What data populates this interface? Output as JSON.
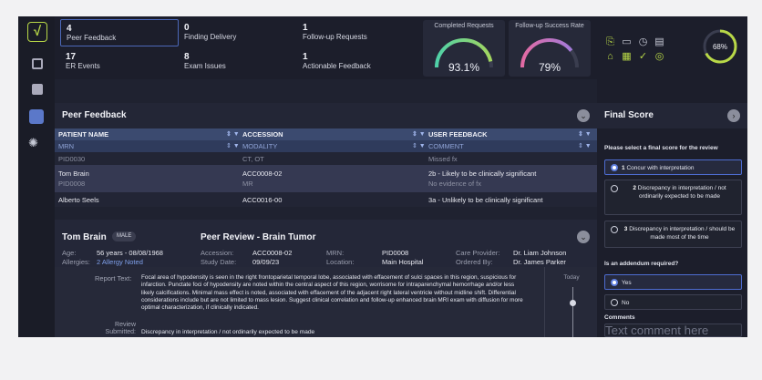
{
  "stats": [
    {
      "num": "4",
      "label": "Peer Feedback"
    },
    {
      "num": "0",
      "label": "Finding Delivery"
    },
    {
      "num": "1",
      "label": "Follow-up Requests"
    },
    {
      "num": "17",
      "label": "ER Events"
    },
    {
      "num": "8",
      "label": "Exam Issues"
    },
    {
      "num": "1",
      "label": "Actionable Feedback"
    }
  ],
  "gauges": [
    {
      "title": "Completed Requests",
      "value": "93.1%",
      "fraction": 0.931
    },
    {
      "title": "Follow-up Success Rate",
      "value": "79%",
      "fraction": 0.79
    }
  ],
  "panel": {
    "title": "Peer Feedback"
  },
  "table": {
    "headers": [
      "PATIENT NAME",
      "ACCESSION",
      "USER FEEDBACK"
    ],
    "subheaders": [
      "MRN",
      "MODALITY",
      "COMMENT"
    ],
    "rows": [
      {
        "name": "",
        "mrn": "PID0030",
        "accession": "",
        "modality": "CT, OT",
        "feedback": "",
        "comment": "Missed fx"
      },
      {
        "name": "Tom Brain",
        "mrn": "PID0008",
        "accession": "ACC0008-02",
        "modality": "MR",
        "feedback": "2b - Likely to be clinically significant",
        "comment": "No evidence of fx"
      },
      {
        "name": "Alberto Seels",
        "mrn": "",
        "accession": "ACC0016-00",
        "modality": "",
        "feedback": "3a - Unlikely to be clinically significant",
        "comment": ""
      }
    ]
  },
  "detail": {
    "name": "Tom Brain",
    "sex": "MALE",
    "review_title": "Peer Review - Brain Tumor",
    "age_label": "Age:",
    "age_value": "56 years - 08/08/1968",
    "allergies_label": "Allergies:",
    "allergies_value": "2 Allergy Noted",
    "accession_label": "Accession:",
    "accession_value": "ACC0008-02",
    "study_date_label": "Study Date:",
    "study_date_value": "09/09/23",
    "mrn_label": "MRN:",
    "mrn_value": "PID0008",
    "location_label": "Location:",
    "location_value": "Main Hospital",
    "care_label": "Care Provider:",
    "care_value": "Dr. Liam Johnson",
    "ordered_label": "Ordered By:",
    "ordered_value": "Dr. James Parker",
    "report_label": "Report Text:",
    "report_text": "Focal area of hypodensity is seen in the right frontoparietal temporal lobe, associated with effacement of sulci spaces in this region, suspicious for infarction. Punctate foci of hypodensity are noted within the central aspect of this region, worrisome for intraparenchymal hemorrhage and/or less likely calcifications. Minimal mass effect is noted, associated with effacement of the adjacent right lateral ventricle without midline shift. Differential considerations include but are not limited to mass lesion. Suggest clinical correlation and follow-up enhanced brain MRI exam with diffusion for more optimal characterization, if clinically indicated.",
    "review_label": "Review Submitted:",
    "review_value": "Discrepancy in interpretation / not ordinarily expected to be made",
    "timeline_label": "Today"
  },
  "right": {
    "progress_value": "68%",
    "progress_fraction": 0.68,
    "title": "Final Score",
    "prompt": "Please select a final score for the review",
    "options": [
      {
        "num": "1",
        "text": "Concur with interpretation"
      },
      {
        "num": "2",
        "text": "Discrepancy in interpretation / not ordinarily expected to be made"
      },
      {
        "num": "3",
        "text": "Discrepancy in interpretation / should be made most of the time"
      }
    ],
    "addendum_prompt": "Is an addendum required?",
    "yes": "Yes",
    "no": "No",
    "comments_label": "Comments",
    "comments_placeholder": "Text comment here"
  },
  "colors": {
    "accent": "#5f7fe0",
    "logo": "#b8d847"
  }
}
